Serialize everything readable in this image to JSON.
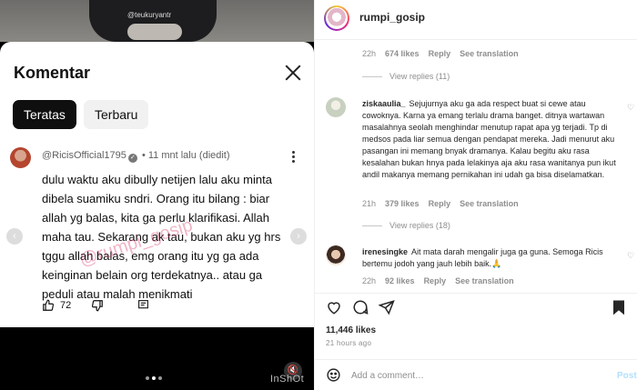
{
  "video": {
    "watermark_top": "@teukuryantr",
    "sheet_title": "Komentar",
    "chips": [
      "Teratas",
      "Terbaru"
    ],
    "comment": {
      "author": "@RicisOfficial1795",
      "verified_mark": "✓",
      "time": "11 mnt lalu (diedit)",
      "lines": [
        "dulu waktu aku dibully netijen lalu aku minta",
        "dibela suamiku sndri. Orang itu bilang : biar",
        "allah yg balas, kita ga perlu klarifikasi. Allah",
        "maha tau. Sekarang ak tau, bukan aku yg hrs",
        "tggu allah balas, emg orang itu yg ga ada",
        "keinginan belain org terdekatnya.. atau ga",
        "peduli atau malah menikmati"
      ],
      "like_count": "72",
      "overlay_watermark": "@rumpi_gosip"
    },
    "inshot_label": "InShOt"
  },
  "ig": {
    "username": "rumpi_gosip",
    "top_meta": {
      "time": "22h",
      "likes": "674 likes",
      "reply": "Reply",
      "translate": "See translation"
    },
    "view_replies_1": "View replies (11)",
    "comments": [
      {
        "username": "ziskaaulia_",
        "text": "Sejujurnya aku ga ada respect buat si cewe atau cowoknya. Karna ya emang terlalu drama banget. ditnya wartawan masalahnya seolah menghindar menutup rapat apa yg terjadi. Tp di medsos pada liar semua dengan pendapat mereka. Jadi menurut aku pasangan ini memang bnyak dramanya. Kalau begitu aku rasa kesalahan bukan hnya pada lelakinya aja aku rasa wanitanya pun ikut andil makanya memang pernikahan ini udah ga bisa diselamatkan.",
        "time": "21h",
        "likes": "379 likes",
        "reply": "Reply",
        "translate": "See translation",
        "view_replies": "View replies (18)"
      },
      {
        "username": "irenesingke",
        "text": "Ait mata darah mengalir juga ga guna. Semoga Ricis bertemu jodoh yang jauh lebih baik.🙏",
        "time": "22h",
        "likes": "92 likes",
        "reply": "Reply",
        "translate": "See translation"
      }
    ],
    "likes_total": "11,446 likes",
    "time_ago": "21 hours ago",
    "comment_placeholder": "Add a comment…",
    "post_label": "Post",
    "colors": {
      "link_blue_disabled": "#b2dffc",
      "meta_gray": "#8e8e8e"
    }
  }
}
